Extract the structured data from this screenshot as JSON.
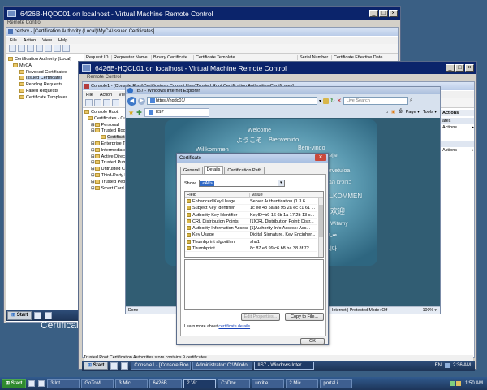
{
  "vm1": {
    "title": "6426B-HQDC01 on localhost - Virtual Machine Remote Control",
    "subtitle": "Remote Control",
    "certsrv_title": "certsrv - [Certification Authority (Local)\\MyCA\\Issued Certificates]",
    "menu": [
      "File",
      "Action",
      "View",
      "Help"
    ],
    "tree": [
      {
        "label": "Certification Authority (Local)",
        "level": 0
      },
      {
        "label": "MyCA",
        "level": 1
      },
      {
        "label": "Revoked Certificates",
        "level": 2
      },
      {
        "label": "Issued Certificates",
        "level": 2
      },
      {
        "label": "Pending Requests",
        "level": 2
      },
      {
        "label": "Failed Requests",
        "level": 2
      },
      {
        "label": "Certificate Templates",
        "level": 2
      }
    ],
    "columns": [
      "Request ID",
      "Requester Name",
      "Binary Certificate",
      "Certificate Template",
      "Serial Number",
      "Certificate Effective Date"
    ],
    "taskbar_start": "Start",
    "background_text": "Certifical"
  },
  "vm2": {
    "title": "6426B-HQCL01 on localhost - Virtual Machine Remote Control",
    "subtitle": "Remote Control",
    "console_title": "Console1 - [Console Root\\Certificates - Current User\\Trusted Root Certification Authorities\\Certificates]",
    "menu": [
      "File",
      "Action",
      "View"
    ],
    "tree": [
      {
        "label": "Console Root",
        "level": 0
      },
      {
        "label": "Certificates - Cur",
        "level": 1
      },
      {
        "label": "Personal",
        "level": 2
      },
      {
        "label": "Trusted Root",
        "level": 2
      },
      {
        "label": "Certificat",
        "level": 3
      },
      {
        "label": "Enterprise Tr",
        "level": 2
      },
      {
        "label": "Intermediate",
        "level": 2
      },
      {
        "label": "Active Direct",
        "level": 2
      },
      {
        "label": "Trusted Publi",
        "level": 2
      },
      {
        "label": "Untrusted Ce",
        "level": 2
      },
      {
        "label": "Third-Party R",
        "level": 2
      },
      {
        "label": "Trusted Peop",
        "level": 2
      },
      {
        "label": "Smart Card T",
        "level": 2
      }
    ],
    "actions_header": "Actions",
    "actions": [
      "ates",
      "Actions",
      "Actions"
    ],
    "status_bar": "Trusted Root Certification Authorities store contains 9 certificates.",
    "taskbar": {
      "start": "Start",
      "items": [
        "Console1 - [Console Roo...",
        "Administrator: C:\\Windo...",
        "IIS7 - Windows Inter..."
      ],
      "lang": "EN",
      "time": "2:36 AM"
    }
  },
  "ie": {
    "title": "IIS7 - Windows Internet Explorer",
    "address": "https://hqdc01/",
    "search_placeholder": "Live Search",
    "tab_label": "IIS7",
    "commands": [
      "Page",
      "Tools"
    ],
    "status_left": "Done",
    "status_right": "Internet | Protected Mode: Off",
    "zoom": "100%",
    "welcome_words": [
      "Welcome",
      "Bienvenido",
      "ようこそ",
      "Willkommen",
      "Bem-vindo",
      "Vitejte",
      "Tervetuloa",
      "ברוכים הבאים",
      "VELKOMMEN",
      "欢迎",
      "Witamy",
      "مرحبا",
      "환영합니다"
    ]
  },
  "dialog": {
    "title": "Certificate",
    "tabs": [
      "General",
      "Details",
      "Certification Path"
    ],
    "active_tab": "Details",
    "show_label": "Show:",
    "show_value": "<All>",
    "col_field": "Field",
    "col_value": "Value",
    "fields": [
      {
        "field": "Enhanced Key Usage",
        "value": "Server Authentication (1.3.6..."
      },
      {
        "field": "Subject Key Identifier",
        "value": "1c ee 48 5a a8 95 2a ec c1 61 ..."
      },
      {
        "field": "Authority Key Identifier",
        "value": "KeyID=b9 16 6b 1a 17 2b 13 c..."
      },
      {
        "field": "CRL Distribution Points",
        "value": "[1]CRL Distribution Point: Distr..."
      },
      {
        "field": "Authority Information Access",
        "value": "[1]Authority Info Access: Acc..."
      },
      {
        "field": "Key Usage",
        "value": "Digital Signature, Key Encipher..."
      },
      {
        "field": "Thumbprint algorithm",
        "value": "sha1"
      },
      {
        "field": "Thumbprint",
        "value": "8c 87 e3 99 c6 b8 ba 38 8f 72 ..."
      }
    ],
    "edit_properties": "Edit Properties...",
    "copy_to_file": "Copy to File...",
    "learn_prefix": "Learn more about ",
    "learn_link": "certificate details",
    "ok": "OK"
  },
  "host_taskbar": {
    "start": "Start",
    "items": [
      "3 Int...",
      "GoToM...",
      "3 Mic...",
      "6426B",
      "2 Vir...",
      "C:\\Doc...",
      "untitle...",
      "2 Mic...",
      "portal.i..."
    ],
    "time": "1:50 AM"
  },
  "colors": {
    "vm_title": "#0b246b",
    "taskbar": "#1d3456",
    "desktop": "#3a5f84",
    "iis_bg": "#2f5d72"
  }
}
